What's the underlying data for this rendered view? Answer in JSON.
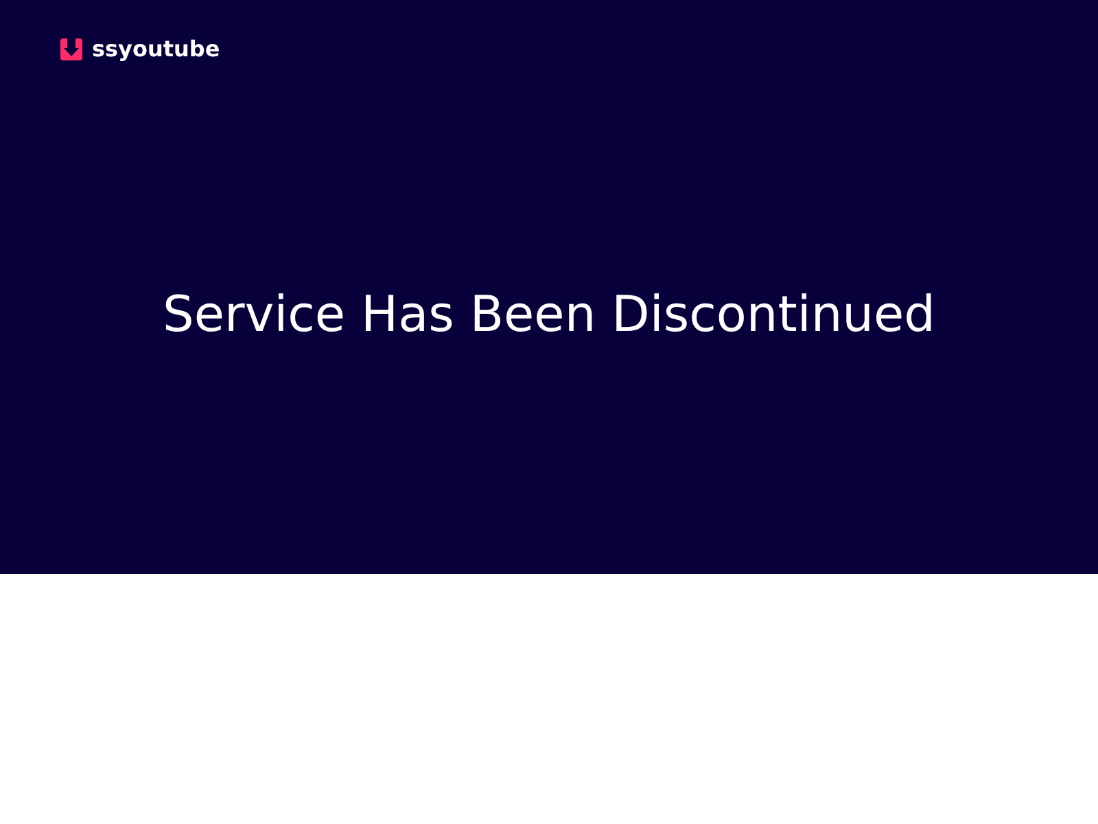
{
  "header": {
    "logo_text": "ssyoutube"
  },
  "hero": {
    "title": "Service Has Been Discontinued"
  }
}
